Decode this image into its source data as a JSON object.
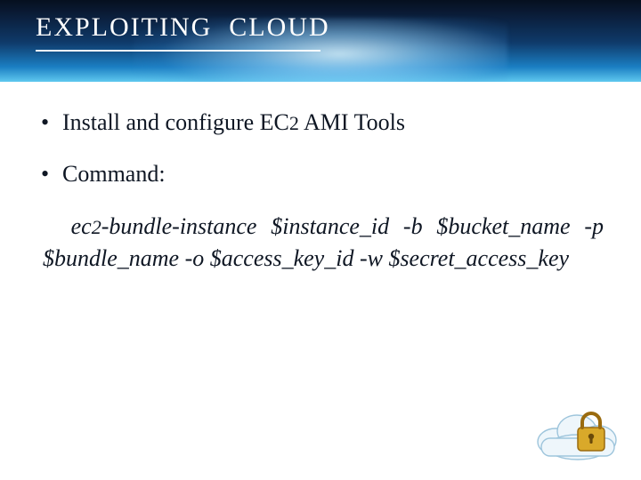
{
  "header": {
    "title_html": "EXPLOITING&nbsp;&nbsp;CLOUD"
  },
  "bullets": {
    "b1_html": "Install and configure EC<span class=\"sc2\">2</span> AMI Tools",
    "b2": "Command:"
  },
  "command_html": "&nbsp;&nbsp;ec<span class=\"sc2\">2</span>-bundle-instance $instance_id -b $bucket_name -p $bundle_name -o $access_key_id -w $secret_access_key",
  "icon": {
    "name": "cloud-lock-icon"
  }
}
